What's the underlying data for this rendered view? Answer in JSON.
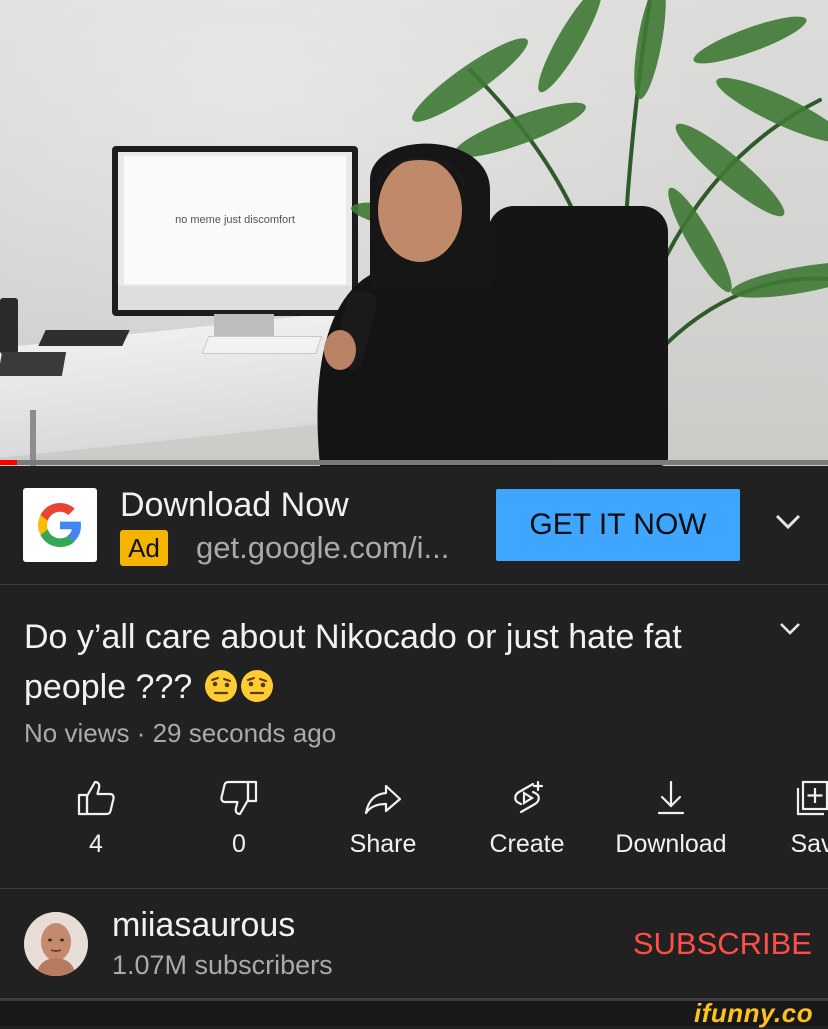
{
  "video": {
    "screen_text": "no meme just discomfort",
    "progress_fraction": 0.02
  },
  "ad": {
    "title": "Download Now",
    "badge": "Ad",
    "url": "get.google.com/i...",
    "cta": "GET IT NOW",
    "logo_icon": "google-g-logo",
    "cta_color": "#3ea6ff",
    "badge_color": "#f4b400"
  },
  "video_info": {
    "title": "Do y’all care about Nikocado or just hate fat people ???",
    "emoji_icons": [
      "face-with-raised-eyebrow",
      "face-with-raised-eyebrow"
    ],
    "meta": "No views · 29 seconds ago"
  },
  "actions": {
    "like": "4",
    "dislike": "0",
    "share": "Share",
    "create": "Create",
    "download": "Download",
    "save": "Sav"
  },
  "channel": {
    "name": "miiasaurous",
    "subscribers": "1.07M subscribers",
    "subscribe_label": "SUBSCRIBE",
    "subscribe_color": "#ff4e45"
  },
  "watermark": "ifunny.co"
}
